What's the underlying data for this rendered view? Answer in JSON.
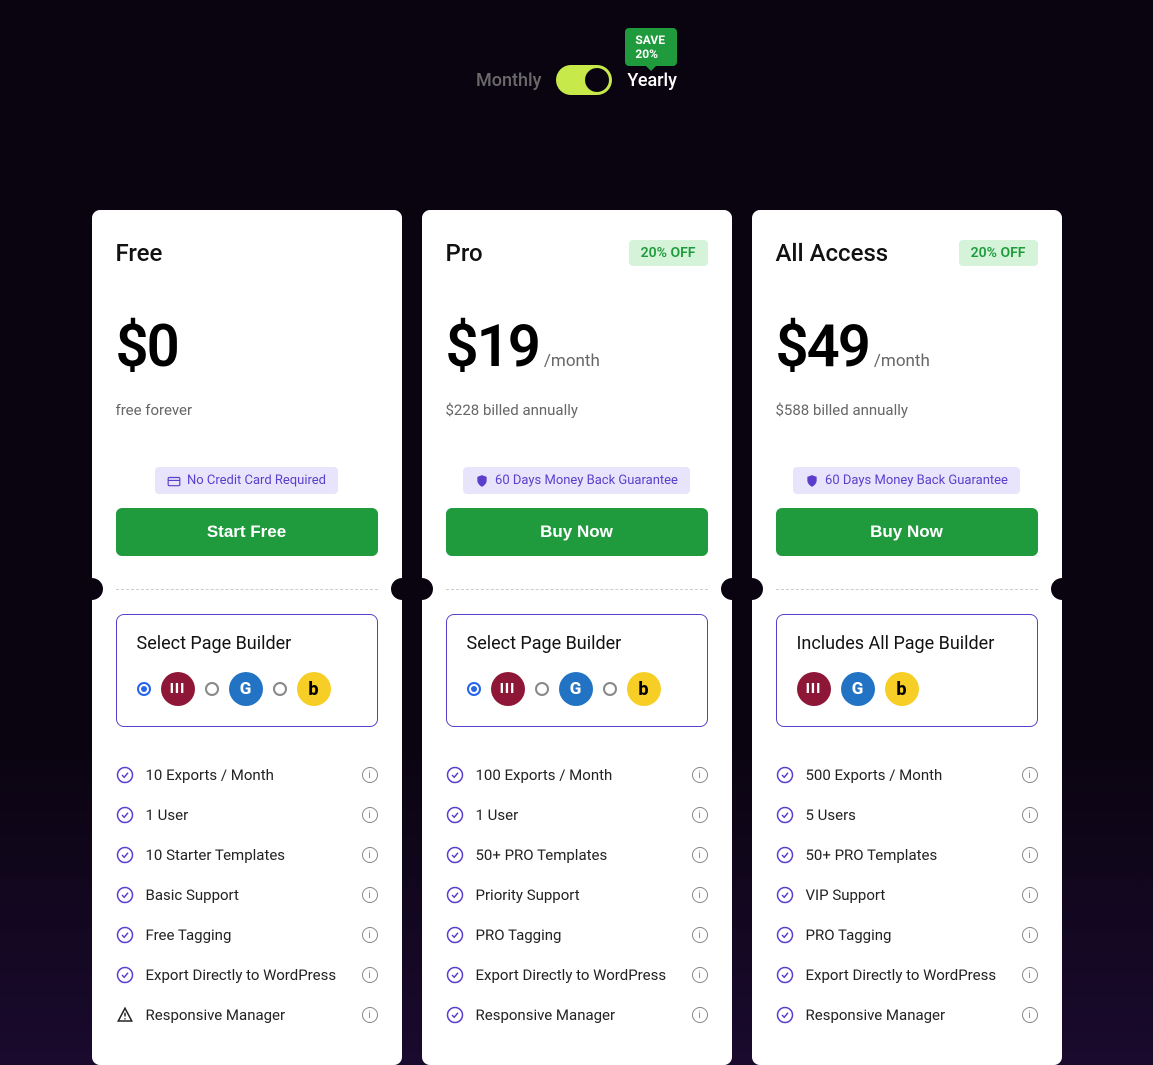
{
  "toggle": {
    "monthly": "Monthly",
    "yearly": "Yearly",
    "save_badge": "SAVE 20%"
  },
  "plans": [
    {
      "name": "Free",
      "discount": "",
      "price": "$0",
      "period": "",
      "subtext": "free forever",
      "guarantee": "No Credit Card Required",
      "guarantee_icon": "card",
      "cta": "Start Free",
      "builder_title": "Select Page Builder",
      "builder_mode": "select",
      "features": [
        {
          "text": "10 Exports / Month",
          "icon": "check"
        },
        {
          "text": "1 User",
          "icon": "check"
        },
        {
          "text": "10 Starter Templates",
          "icon": "check"
        },
        {
          "text": "Basic Support",
          "icon": "check"
        },
        {
          "text": "Free Tagging",
          "icon": "check"
        },
        {
          "text": "Export Directly to WordPress",
          "icon": "check"
        },
        {
          "text": "Responsive Manager",
          "icon": "warn"
        }
      ]
    },
    {
      "name": "Pro",
      "discount": "20% OFF",
      "price": "$19",
      "period": "/month",
      "subtext": "$228 billed annually",
      "guarantee": "60 Days Money Back Guarantee",
      "guarantee_icon": "shield",
      "cta": "Buy Now",
      "builder_title": "Select Page Builder",
      "builder_mode": "select",
      "features": [
        {
          "text": "100 Exports / Month",
          "icon": "check"
        },
        {
          "text": "1 User",
          "icon": "check"
        },
        {
          "text": "50+ PRO Templates",
          "icon": "check"
        },
        {
          "text": "Priority Support",
          "icon": "check"
        },
        {
          "text": "PRO Tagging",
          "icon": "check"
        },
        {
          "text": "Export Directly to WordPress",
          "icon": "check"
        },
        {
          "text": "Responsive Manager",
          "icon": "check"
        }
      ]
    },
    {
      "name": "All Access",
      "discount": "20% OFF",
      "price": "$49",
      "period": "/month",
      "subtext": "$588 billed annually",
      "guarantee": "60 Days Money Back Guarantee",
      "guarantee_icon": "shield",
      "cta": "Buy Now",
      "builder_title": "Includes All Page Builder",
      "builder_mode": "all",
      "features": [
        {
          "text": "500 Exports / Month",
          "icon": "check"
        },
        {
          "text": "5 Users",
          "icon": "check"
        },
        {
          "text": "50+ PRO Templates",
          "icon": "check"
        },
        {
          "text": "VIP Support",
          "icon": "check"
        },
        {
          "text": "PRO Tagging",
          "icon": "check"
        },
        {
          "text": "Export Directly to WordPress",
          "icon": "check"
        },
        {
          "text": "Responsive Manager",
          "icon": "check"
        }
      ]
    }
  ]
}
